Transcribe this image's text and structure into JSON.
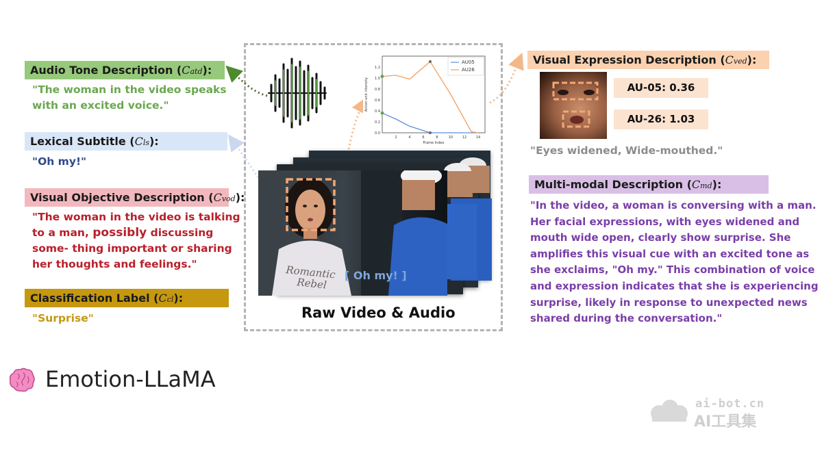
{
  "left": {
    "audio_tone": {
      "label": "Audio Tone Description (",
      "sym": "C",
      "sub": "atd",
      "suffix": "):",
      "color": "#96c97b",
      "text_color": "#6aa84f",
      "desc_line1": "\"The woman in the video speaks",
      "desc_line2": "with an excited  voice.\""
    },
    "lexical": {
      "label": "Lexical Subtitle (",
      "sym": "C",
      "sub": "ls",
      "suffix": "):",
      "color": "#d9e6f7",
      "text_color": "#2f4a8a",
      "desc": "\"Oh my!\""
    },
    "visual_objective": {
      "label": "Visual Objective Description (",
      "sym": "C",
      "sub": "vod",
      "suffix": "):",
      "color": "#f2b8bd",
      "text_color": "#b8202b",
      "line1": "\"The woman in the video is talking",
      "line2a": "to a man, ",
      "line2b": "possibly",
      "line2c": " discussing",
      "line3": "some- thing important or sharing",
      "line4": "her thoughts and feelings.\""
    },
    "classification": {
      "label": "Classification Label (",
      "sym": "C",
      "sub": "cl",
      "suffix": "):",
      "color": "#c5980f",
      "text_color": "#c5980f",
      "desc": "\"Surprise\""
    }
  },
  "center": {
    "caption": "Raw Video & Audio",
    "subtitle_overlay": "[ Oh my! ]",
    "shirt_text_1": "Romantic",
    "shirt_text_2": "Rebel"
  },
  "chart": {
    "legend_au05": "AU05",
    "legend_au26": "AU26",
    "xlabel": "Frame Index",
    "ylabel": "Action unit intensity",
    "au05_color": "#5b8fd6",
    "au26_color": "#f0a060"
  },
  "chart_data": {
    "type": "line",
    "x": [
      0,
      2,
      4,
      7,
      10,
      13,
      14
    ],
    "series": [
      {
        "name": "AU05",
        "values": [
          0.36,
          0.25,
          0.12,
          0.0,
          0.0,
          0.0,
          0.0
        ]
      },
      {
        "name": "AU26",
        "values": [
          1.03,
          1.05,
          0.98,
          1.3,
          0.7,
          0.02,
          0.0
        ]
      }
    ],
    "xticks": [
      2,
      4,
      6,
      8,
      10,
      12,
      14
    ],
    "yticks": [
      0.0,
      0.2,
      0.4,
      0.6,
      0.8,
      1.0,
      1.2
    ],
    "xlabel": "Frame Index",
    "ylabel": "Action unit intensity",
    "xlim": [
      0,
      15
    ],
    "ylim": [
      0,
      1.4
    ],
    "legend": "top-right"
  },
  "right": {
    "visual_expression": {
      "label": "Visual Expression Description (",
      "sym": "C",
      "sub": "ved",
      "suffix": "):",
      "color": "#fbd1b0"
    },
    "au05": "AU-05: 0.36",
    "au26": "AU-26: 1.03",
    "expression_desc": "\"Eyes widened, Wide-mouthed.\"",
    "multimodal": {
      "label": "Multi-modal Description (",
      "sym": "C",
      "sub": "md",
      "suffix": "):",
      "color": "#d9bfe6",
      "text_color": "#7a3ea8",
      "lines": [
        "\"In the video, a woman is conversing with a man.",
        "Her facial expressions, with eyes widened and",
        "mouth wide open, clearly show surprise. She",
        "amplifies this visual cue with an excited tone as",
        "she exclaims, \"Oh my.\" This combination of voice",
        "and expression indicates that she is experiencing",
        "surprise, likely in response to unexpected news",
        "shared during the conversation.\""
      ]
    }
  },
  "footer": {
    "title": "Emotion-LLaMA",
    "icon": "brain-icon"
  },
  "watermark": {
    "url": "ai-bot.cn",
    "name": "AI工具集"
  }
}
